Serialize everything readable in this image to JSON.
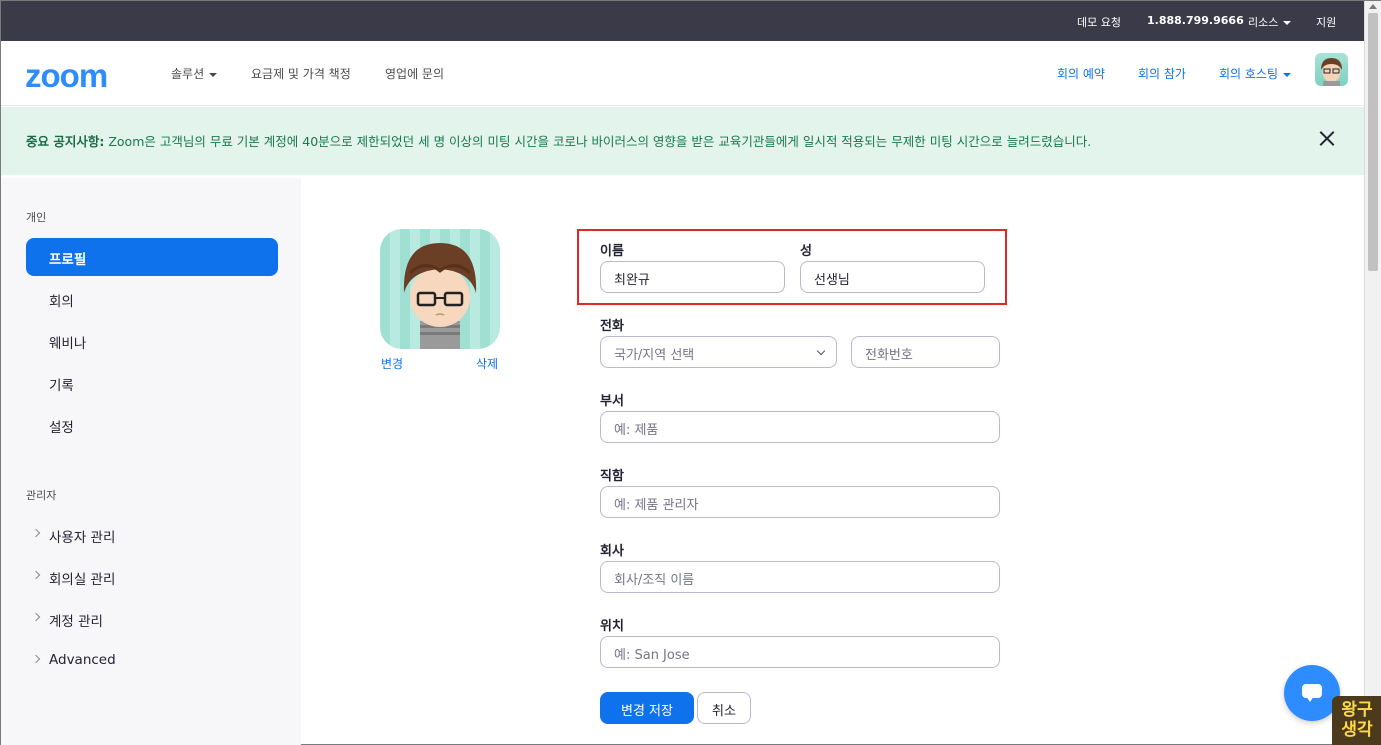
{
  "topbar": {
    "demo_request": "데모 요청",
    "phone": "1.888.799.9666",
    "resources": "리소스",
    "support": "지원"
  },
  "header": {
    "logo": "zoom",
    "nav": {
      "solutions": "솔루션",
      "pricing": "요금제 및 가격 책정",
      "contact_sales": "영업에 문의"
    },
    "actions": {
      "schedule": "회의 예약",
      "join": "회의 참가",
      "host": "회의 호스팅"
    }
  },
  "notice": {
    "title": "중요 공지사항:",
    "body": "Zoom은 고객님의 무료 기본 계정에 40분으로 제한되었던 세 명 이상의 미팅 시간을 코로나 바이러스의 영향을 받은 교육기관들에게 일시적 적용되는 무제한 미팅 시간으로 늘려드렸습니다."
  },
  "sidebar": {
    "personal_label": "개인",
    "personal_items": [
      "프로필",
      "회의",
      "웨비나",
      "기록",
      "설정"
    ],
    "admin_label": "관리자",
    "admin_items": [
      "사용자 관리",
      "회의실 관리",
      "계정 관리",
      "Advanced"
    ]
  },
  "profile": {
    "change_link": "변경",
    "delete_link": "삭제"
  },
  "form": {
    "first_name": {
      "label": "이름",
      "value": "최완규"
    },
    "last_name": {
      "label": "성",
      "value": "선생님"
    },
    "phone": {
      "label": "전화",
      "country_placeholder": "국가/지역 선택",
      "number_placeholder": "전화번호"
    },
    "department": {
      "label": "부서",
      "placeholder": "예: 제품"
    },
    "job_title": {
      "label": "직함",
      "placeholder": "예: 제품 관리자"
    },
    "company": {
      "label": "회사",
      "placeholder": "회사/조직 이름"
    },
    "location": {
      "label": "위치",
      "placeholder": "예: San Jose"
    },
    "save_button": "변경 저장",
    "cancel_button": "취소"
  },
  "watermark": {
    "line1": "왕구",
    "line2": "생각"
  },
  "colors": {
    "brand_blue": "#2d8cff",
    "action_blue": "#0e72ed",
    "notice_bg": "#e3f4ec",
    "highlight_red": "#e02828"
  }
}
